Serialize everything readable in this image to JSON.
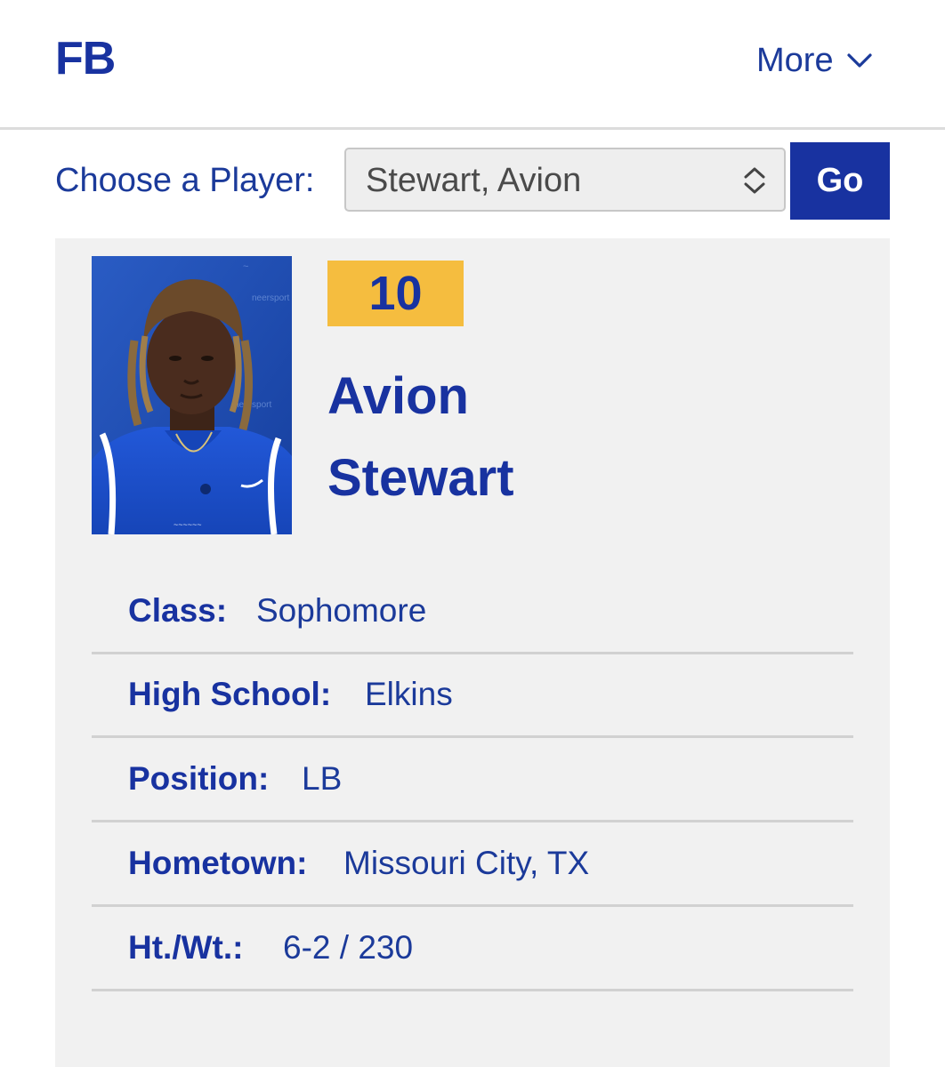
{
  "header": {
    "brand": "FB",
    "more_label": "More",
    "more_icon": "chevron-down-icon"
  },
  "chooser": {
    "label": "Choose a Player:",
    "selected": "Stewart, Avion",
    "select_icon": "up-down-arrows-icon",
    "go_label": "Go"
  },
  "player": {
    "number": "10",
    "first_name": "Avion",
    "last_name": "Stewart",
    "photo_icon": "player-headshot",
    "details": [
      {
        "label": "Class:",
        "value": "Sophomore"
      },
      {
        "label": "High School:",
        "value": "Elkins"
      },
      {
        "label": "Position:",
        "value": "LB"
      },
      {
        "label": "Hometown:",
        "value": "Missouri City, TX"
      },
      {
        "label": "Ht./Wt.:",
        "value": "6-2 / 230"
      }
    ]
  },
  "colors": {
    "primary": "#1832a0",
    "badge": "#f5bd3f",
    "card_bg": "#f1f1f1"
  }
}
